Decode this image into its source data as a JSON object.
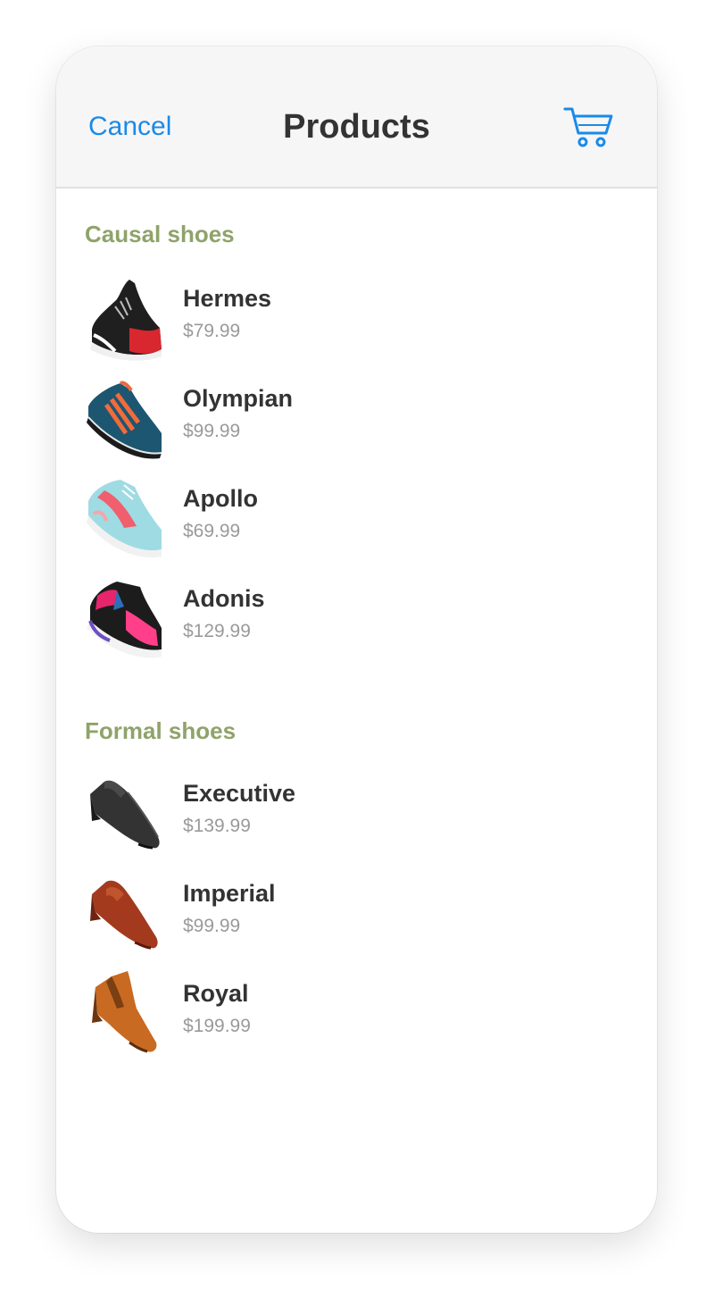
{
  "navbar": {
    "cancel_label": "Cancel",
    "title": "Products",
    "cart_icon": "shopping-cart-icon"
  },
  "sections": [
    {
      "title": "Causal shoes",
      "items": [
        {
          "name": "Hermes",
          "price": "$79.99",
          "icon": "sneaker-image"
        },
        {
          "name": "Olympian",
          "price": "$99.99",
          "icon": "sneaker-image"
        },
        {
          "name": "Apollo",
          "price": "$69.99",
          "icon": "sneaker-image"
        },
        {
          "name": "Adonis",
          "price": "$129.99",
          "icon": "sneaker-image"
        }
      ]
    },
    {
      "title": "Formal shoes",
      "items": [
        {
          "name": "Executive",
          "price": "$139.99",
          "icon": "dress-shoe-image"
        },
        {
          "name": "Imperial",
          "price": "$99.99",
          "icon": "loafer-image"
        },
        {
          "name": "Royal",
          "price": "$199.99",
          "icon": "chelsea-boot-image"
        }
      ]
    }
  ],
  "colors": {
    "accent": "#1a8ae8",
    "section_header": "#8fa36a",
    "title_text": "#333333",
    "price_text": "#9a9a9a",
    "navbar_bg": "#f6f6f6"
  }
}
